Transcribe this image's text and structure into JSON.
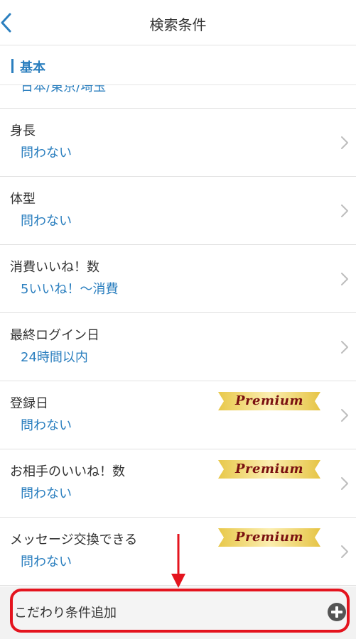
{
  "header": {
    "title": "検索条件"
  },
  "section": {
    "title": "基本"
  },
  "clipped_row": {
    "value": "日本/東京/埼玉"
  },
  "rows": [
    {
      "label": "身長",
      "value": "問わない",
      "premium": false
    },
    {
      "label": "体型",
      "value": "問わない",
      "premium": false
    },
    {
      "label": "消費いいね！数",
      "value": "5いいね！〜消費",
      "premium": false
    },
    {
      "label": "最終ログイン日",
      "value": "24時間以内",
      "premium": false
    },
    {
      "label": "登録日",
      "value": "問わない",
      "premium": true
    },
    {
      "label": "お相手のいいね！数",
      "value": "問わない",
      "premium": true
    },
    {
      "label": "メッセージ交換できる",
      "value": "問わない",
      "premium": true
    }
  ],
  "premium_badge": {
    "label": "Premium"
  },
  "add_condition": {
    "label": "こだわり条件追加"
  },
  "colors": {
    "accent": "#2b7fbf",
    "highlight": "#e4141e",
    "premium_text": "#7a1010"
  }
}
